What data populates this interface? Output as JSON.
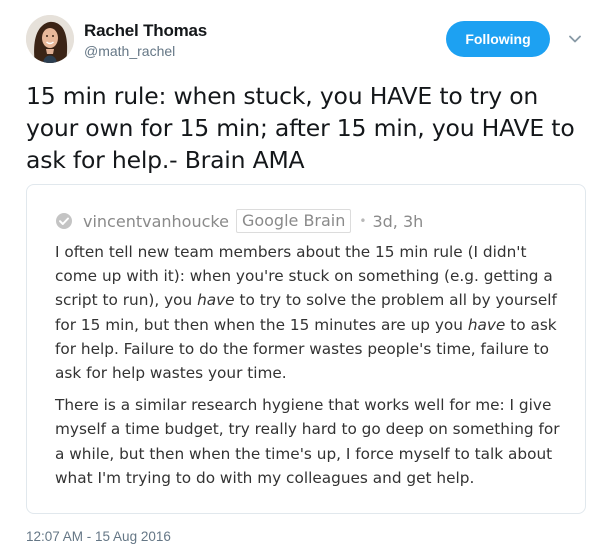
{
  "author": {
    "name": "Rachel Thomas",
    "handle": "@math_rachel"
  },
  "follow_button": {
    "label": "Following",
    "color": "#1da1f2"
  },
  "caret": {
    "icon": "chevron-down-icon"
  },
  "tweet": {
    "text": "15 min rule: when stuck, you HAVE to try on your own for 15 min; after 15 min, you HAVE to ask for help.- Brain AMA"
  },
  "quoted_image": {
    "icon": "check-circle-icon",
    "username": "vincentvanhoucke",
    "badge": "Google Brain",
    "separator": "•",
    "time": "3d, 3h",
    "paragraph1": {
      "part1": "I often tell new team members about the 15 min rule (I didn't come up with it): when you're stuck on something (e.g. getting a script to run), you ",
      "em1": "have",
      "part2": " to try to solve the problem all by yourself for 15 min, but then when the 15 minutes are up you ",
      "em2": "have",
      "part3": " to ask for help. Failure to do the former wastes people's time, failure to ask for help wastes your time."
    },
    "paragraph2": "There is a similar research hygiene that works well for me: I give myself a time budget, try really hard to go deep on something for a while, but then when the time's up, I force myself to talk about what I'm trying to do with my colleagues and get help."
  },
  "timestamp": "12:07 AM - 15 Aug 2016"
}
